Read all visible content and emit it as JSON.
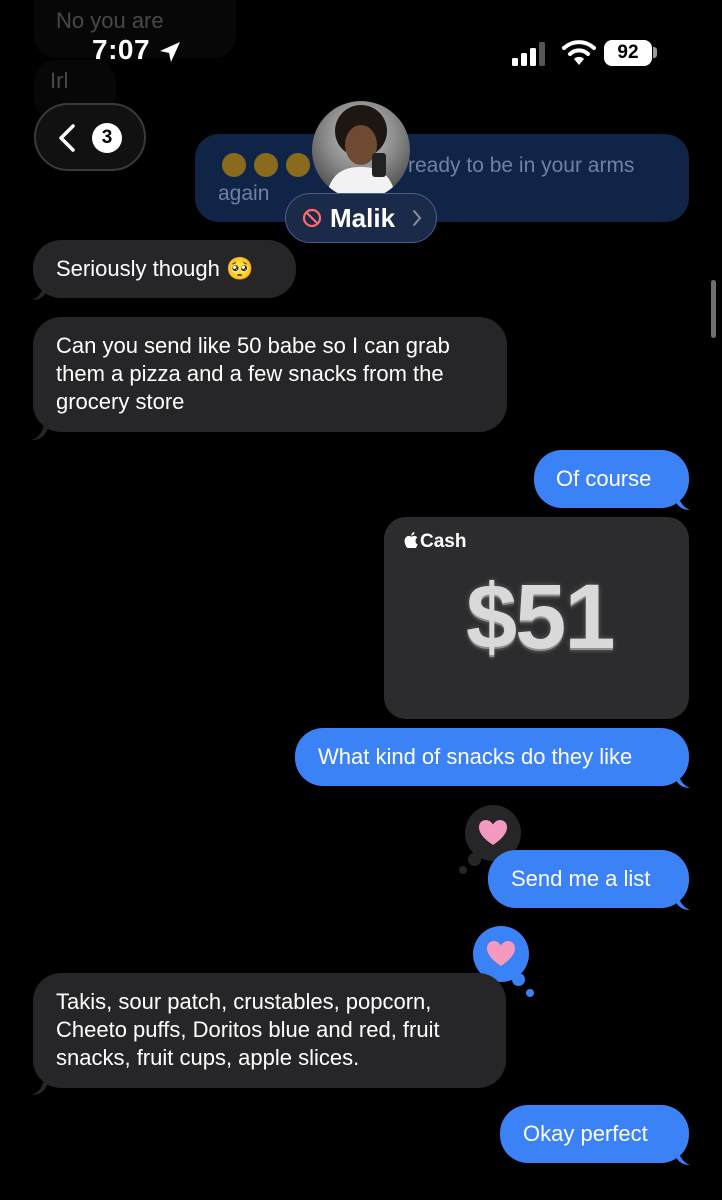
{
  "ghost_messages": [
    "No you are",
    "Irl"
  ],
  "status_bar": {
    "time": "7:07",
    "battery": "92"
  },
  "nav": {
    "back_badge": "3",
    "contact_name": "Malik"
  },
  "previous_message": {
    "emojis": [
      "🥺",
      "🥺",
      "🥺"
    ],
    "text_line1": "ready to be in your arms",
    "text_line2": "again"
  },
  "messages": [
    {
      "from": "them",
      "text": "Seriously though 🥺"
    },
    {
      "from": "them",
      "text": "Can you send like 50 babe so I can grab them a pizza and a few snacks from the grocery store"
    },
    {
      "from": "me",
      "text": "Of course"
    },
    {
      "from": "me",
      "type": "apple_cash",
      "brand": "Cash",
      "amount": "$51"
    },
    {
      "from": "me",
      "text": "What kind of snacks do they like",
      "tapback": "heart"
    },
    {
      "from": "me",
      "text": "Send me a list"
    },
    {
      "from": "them",
      "text": "Takis, sour patch, crustables, popcorn, Cheeto puffs, Doritos blue and red, fruit snacks, fruit cups, apple slices.",
      "tapback": "heart"
    },
    {
      "from": "me",
      "text": "Okay perfect"
    }
  ],
  "colors": {
    "sent": "#3b82f6",
    "received": "#262628",
    "background": "#000000",
    "heart": "#f49ac1"
  }
}
